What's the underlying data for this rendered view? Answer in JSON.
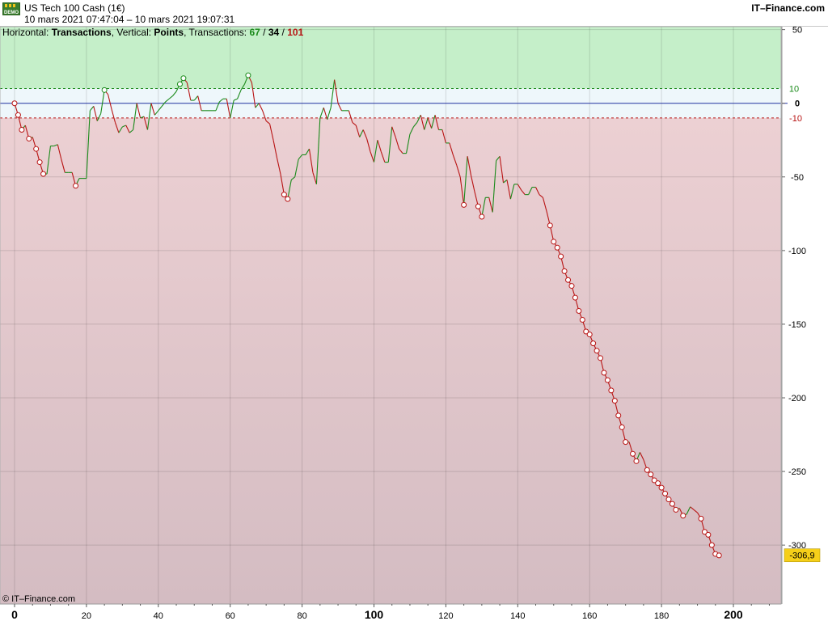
{
  "header": {
    "title": "US Tech 100 Cash (1€)",
    "range": "10 mars 2021 07:47:04 – 10 mars 2021 19:07:31",
    "brand": "IT–Finance.com",
    "demo_badge": "DEMO"
  },
  "infobar": {
    "h_prefix": "Horizontal: ",
    "h_value": "Transactions",
    "v_prefix": ", Vertical: ",
    "v_value": "Points",
    "t_prefix": ", Transactions: ",
    "wins": "67",
    "sep1": " / ",
    "neutral": "34",
    "sep2": " / ",
    "total": "101"
  },
  "footer": {
    "copyright": "© IT–Finance.com"
  },
  "colors": {
    "up": "#1a8a1a",
    "down": "#b81414",
    "zero_line": "#2030a0",
    "green_zone": "#c5efc9",
    "white_zone": "#eef7fb",
    "red_zone_top": "#ecd0d3",
    "red_zone_bottom": "#d4bcc2",
    "last_badge": "#f5cf19"
  },
  "chart_data": {
    "type": "line",
    "xlim": [
      0,
      213
    ],
    "ylim": [
      -340,
      52
    ],
    "yticks": [
      50,
      0,
      -50,
      -100,
      -150,
      -200,
      -250,
      -300
    ],
    "ytick_labels": [
      "50",
      "0",
      "-50",
      "-100",
      "-150",
      "-200",
      "-250",
      "-300"
    ],
    "xticks": [
      0,
      20,
      40,
      60,
      80,
      100,
      120,
      140,
      160,
      180,
      200
    ],
    "xtick_labels": [
      "0",
      "20",
      "40",
      "60",
      "80",
      "100",
      "120",
      "140",
      "160",
      "180",
      "200"
    ],
    "bold_xticks": [
      0,
      100,
      200
    ],
    "upper_band": 10,
    "upper_band_label": "10",
    "lower_band": -10,
    "lower_band_label": "-10",
    "zero_label": "0",
    "last_value": -306.9,
    "last_value_label": "-306,9",
    "series": [
      {
        "values": [
          0,
          -8,
          -18,
          -15,
          -24,
          -23,
          -31,
          -40,
          -48,
          -48,
          -29,
          -29,
          -28,
          -38,
          -47,
          -47,
          -47,
          -56,
          -51,
          -51,
          -51,
          -5,
          -2,
          -12,
          -7,
          9,
          6,
          -4,
          -13,
          -20,
          -16,
          -15,
          -20,
          -18,
          0,
          -10,
          -9,
          -18,
          0,
          -8,
          -5,
          -2,
          1,
          3,
          5,
          8,
          13,
          17,
          14,
          2,
          2,
          5,
          -5,
          -5,
          -5,
          -5,
          -5,
          1,
          3,
          3,
          -10,
          2,
          3,
          9,
          13,
          19,
          14,
          -3,
          0,
          -5,
          -12,
          -14,
          -25,
          -37,
          -48,
          -62,
          -65,
          -52,
          -50,
          -38,
          -35,
          -35,
          -31,
          -47,
          -55,
          -10,
          -3,
          -11,
          -3,
          16,
          0,
          -5,
          -5,
          -5,
          -13,
          -15,
          -23,
          -18,
          -24,
          -33,
          -40,
          -25,
          -33,
          -40,
          -40,
          -16,
          -23,
          -31,
          -34,
          -34,
          -21,
          -16,
          -13,
          -8,
          -18,
          -10,
          -17,
          -8,
          -18,
          -18,
          -27,
          -27,
          -35,
          -42,
          -50,
          -69,
          -36,
          -49,
          -60,
          -70,
          -77,
          -64,
          -64,
          -74,
          -39,
          -36,
          -54,
          -52,
          -65,
          -55,
          -55,
          -59,
          -62,
          -62,
          -57,
          -57,
          -62,
          -64,
          -73,
          -83,
          -94,
          -98,
          -104,
          -114,
          -120,
          -124,
          -132,
          -141,
          -147,
          -155,
          -157,
          -163,
          -168,
          -173,
          -183,
          -188,
          -195,
          -202,
          -212,
          -220,
          -230,
          -230,
          -238,
          -243,
          -237,
          -242,
          -249,
          -252,
          -256,
          -258,
          -261,
          -265,
          -269,
          -272,
          -276,
          -275,
          -280,
          -279,
          -274,
          -276,
          -278,
          -282,
          -291,
          -293,
          -300,
          -306,
          -307
        ]
      }
    ]
  }
}
